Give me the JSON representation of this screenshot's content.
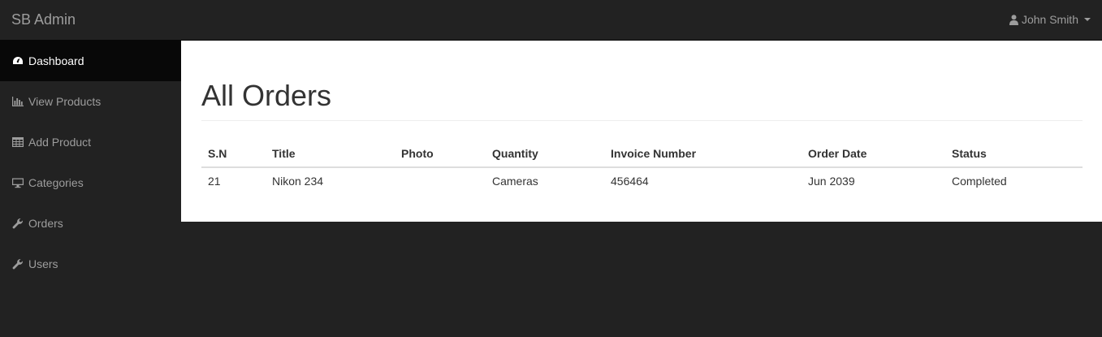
{
  "navbar": {
    "brand": "SB Admin",
    "user_name": "John Smith"
  },
  "sidebar": {
    "items": [
      {
        "label": "Dashboard",
        "icon": "dashboard-icon"
      },
      {
        "label": "View Products",
        "icon": "bar-chart-icon"
      },
      {
        "label": "Add Product",
        "icon": "table-icon"
      },
      {
        "label": "Categories",
        "icon": "desktop-icon"
      },
      {
        "label": "Orders",
        "icon": "wrench-icon"
      },
      {
        "label": "Users",
        "icon": "wrench-icon"
      }
    ],
    "active": "Dashboard"
  },
  "main": {
    "title": "All Orders",
    "table": {
      "headers": [
        "S.N",
        "Title",
        "Photo",
        "Quantity",
        "Invoice Number",
        "Order Date",
        "Status"
      ],
      "rows": [
        [
          "21",
          "Nikon 234",
          "",
          "Cameras",
          "456464",
          "Jun 2039",
          "Completed"
        ]
      ]
    }
  },
  "colors": {
    "navbar_bg": "#222222",
    "sidebar_active_bg": "#080808",
    "main_bg": "#ffffff",
    "muted_text": "#9d9d9d"
  }
}
